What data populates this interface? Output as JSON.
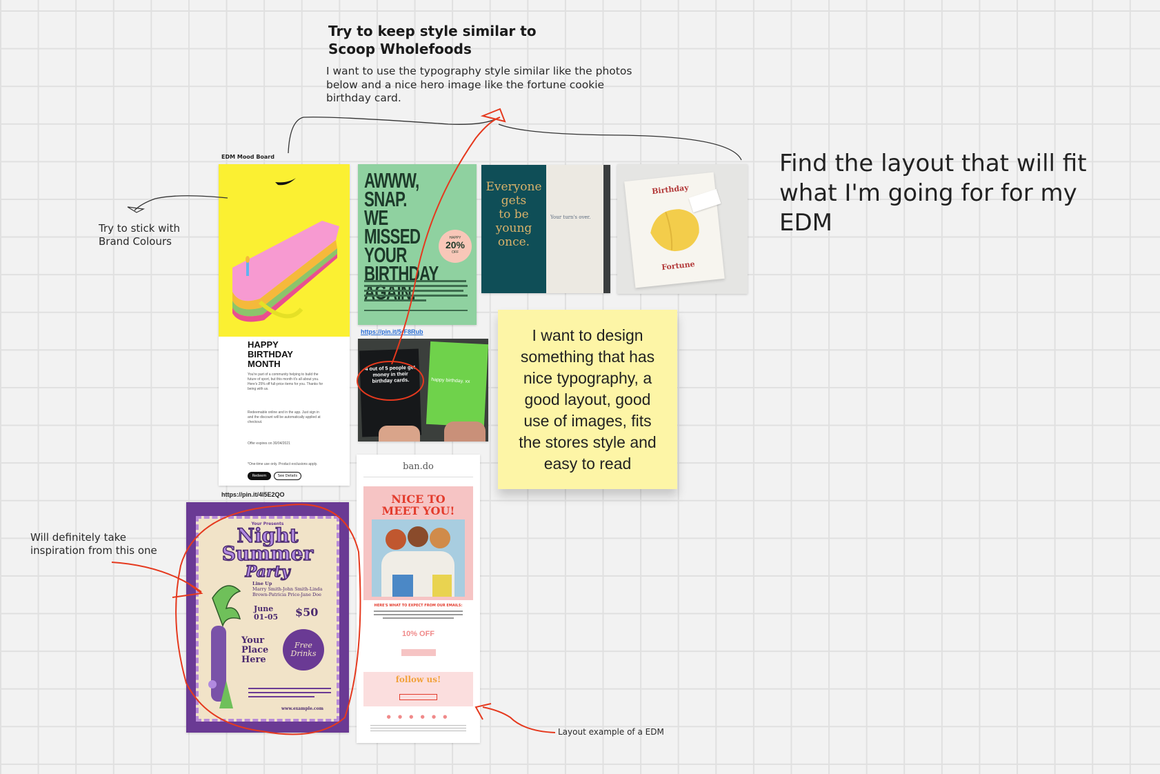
{
  "colors": {
    "background": "#f2f2f2",
    "grid": "#e0e0e0",
    "sticky": "#fdf5a6",
    "annotation_red": "#e5391e",
    "nike_yellow": "#fbf032",
    "awww_green": "#8fd1a0",
    "teal_card": "#0f4e57",
    "party_purple": "#6a3a94",
    "bando_pink": "#f6c4c4"
  },
  "board": {
    "heading_line1": "Try to keep style similar to",
    "heading_line2": "Scoop Wholefoods",
    "intro_line1": "I want to use the typography style similar like the photos",
    "intro_line2": "below and a nice hero image like the fortune cookie",
    "intro_line3": "birthday card.",
    "find_line1": "Find the layout that will fit",
    "find_line2": "what I'm going for for my",
    "find_line3": "EDM",
    "brand_line1": "Try to stick with",
    "brand_line2": "Brand Colours",
    "inspiration_line1": "Will definitely take",
    "inspiration_line2": "inspiration from this one",
    "layout_note": "Layout example of a EDM",
    "moodboard_label": "EDM Mood Board",
    "sticky_note": "I want to design something that has nice typography, a good layout, good use of images, fits the stores style and easy to read"
  },
  "links": {
    "pin_1": "https://pin.it/5rF8Rub",
    "pin_2": "https://pin.it/4I5E2QO"
  },
  "nike": {
    "title_line1": "HAPPY",
    "title_line2": "BIRTHDAY",
    "title_line3": "MONTH",
    "body1": "You're part of a community helping to build the future of sport, but this month it's all about you. Here's 25% off full-price items for you. Thanks for being with us.",
    "body2": "Redeemable online and in the app. Just sign in and the discount will be automatically applied at checkout.",
    "body3": "Offer expires on 30/04/2021",
    "body4": "*One-time use only. Product exclusions apply.",
    "btn_primary": "Redeem",
    "btn_secondary": "See Details"
  },
  "awww": {
    "line1": "AWWW,",
    "line2": "SNAP.",
    "line3": "WE MISSED",
    "line4": "YOUR",
    "line5": "BIRTHDAY",
    "line6": "AGAIN.",
    "badge_top": "HAPPY",
    "badge_main": "20%",
    "badge_bottom": "OFF"
  },
  "teal": {
    "line1": "Everyone",
    "line2": "gets",
    "line3": "to be",
    "line4": "young",
    "line5": "once.",
    "inside": "Your turn's over."
  },
  "fortune": {
    "top": "Birthday",
    "bottom": "Fortune"
  },
  "hands": {
    "black_card": "4 out of 5 people get money in their birthday cards.",
    "green_card": "happy birthday. xx"
  },
  "party": {
    "presents": "Your Presents",
    "title1": "Night",
    "title2": "Summer",
    "title3": "Party",
    "lineup_label": "Line Up",
    "lineup": "Marry Smith-John Smith-Linda Brown-Patricia Price-Jane Doe",
    "date": "June 01-05",
    "price": "$50",
    "place1": "Your",
    "place2": "Place",
    "place3": "Here",
    "badge": "Free Drinks",
    "url": "www.example.com"
  },
  "bando": {
    "logo": "ban.do",
    "headline1": "NICE TO",
    "headline2": "MEET YOU!",
    "subhead": "HERE'S WHAT TO EXPECT FROM OUR EMAILS:",
    "offer": "10% OFF",
    "follow": "follow us!"
  }
}
